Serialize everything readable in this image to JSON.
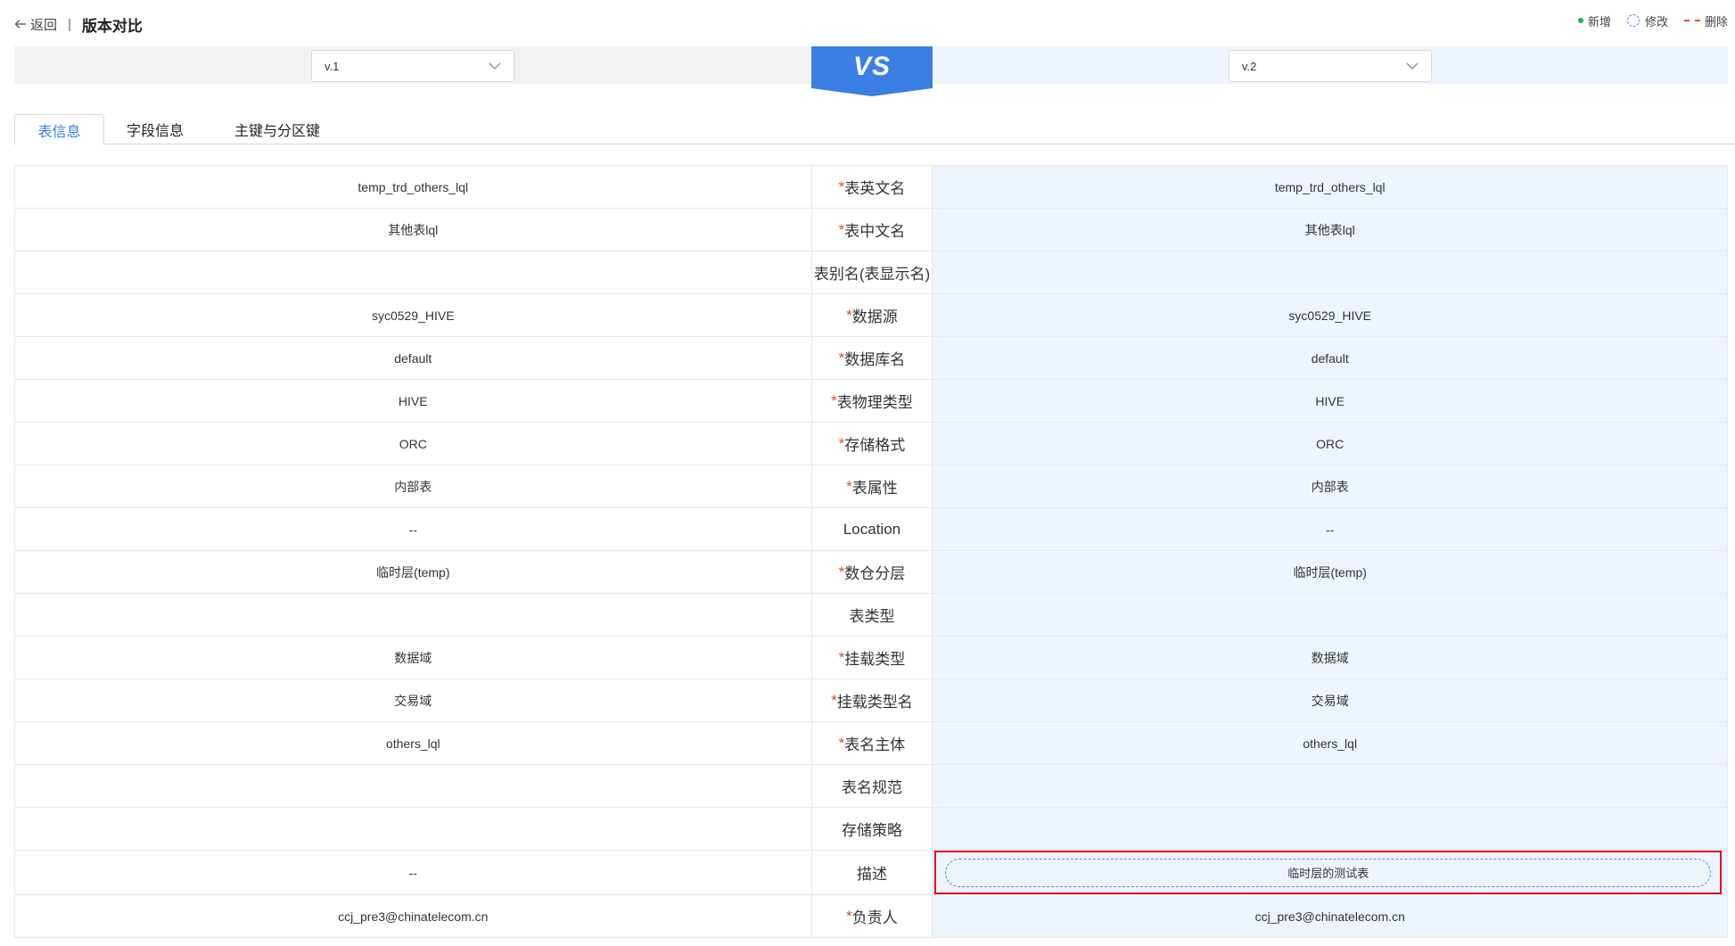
{
  "header": {
    "back_label": "返回",
    "separator": "|",
    "title": "版本对比"
  },
  "legend": {
    "added": "新增",
    "modified": "修改",
    "deleted": "删除"
  },
  "versions": {
    "left": "v.1",
    "right": "v.2",
    "vs_label": "VS"
  },
  "tabs": [
    {
      "label": "表信息",
      "active": true
    },
    {
      "label": "字段信息",
      "active": false
    },
    {
      "label": "主键与分区键",
      "active": false
    }
  ],
  "rows": [
    {
      "label": "表英文名",
      "required": true,
      "left": "temp_trd_others_lql",
      "right": "temp_trd_others_lql"
    },
    {
      "label": "表中文名",
      "required": true,
      "left": "其他表lql",
      "right": "其他表lql"
    },
    {
      "label": "表别名(表显示名)",
      "required": false,
      "left": "",
      "right": ""
    },
    {
      "label": "数据源",
      "required": true,
      "left": "syc0529_HIVE",
      "right": "syc0529_HIVE"
    },
    {
      "label": "数据库名",
      "required": true,
      "left": "default",
      "right": "default"
    },
    {
      "label": "表物理类型",
      "required": true,
      "left": "HIVE",
      "right": "HIVE"
    },
    {
      "label": "存储格式",
      "required": true,
      "left": "ORC",
      "right": "ORC"
    },
    {
      "label": "表属性",
      "required": true,
      "left": "内部表",
      "right": "内部表"
    },
    {
      "label": "Location",
      "required": false,
      "left": "--",
      "right": "--"
    },
    {
      "label": "数仓分层",
      "required": true,
      "left": "临时层(temp)",
      "right": "临时层(temp)"
    },
    {
      "label": "表类型",
      "required": false,
      "left": "",
      "right": ""
    },
    {
      "label": "挂载类型",
      "required": true,
      "left": "数据域",
      "right": "数据域"
    },
    {
      "label": "挂载类型名",
      "required": true,
      "left": "交易域",
      "right": "交易域"
    },
    {
      "label": "表名主体",
      "required": true,
      "left": "others_lql",
      "right": "others_lql"
    },
    {
      "label": "表名规范",
      "required": false,
      "left": "",
      "right": ""
    },
    {
      "label": "存储策略",
      "required": false,
      "left": "",
      "right": ""
    },
    {
      "label": "描述",
      "required": false,
      "left": "--",
      "right": "临时层的测试表",
      "modified": true
    },
    {
      "label": "负责人",
      "required": true,
      "left": "ccj_pre3@chinatelecom.cn",
      "right": "ccj_pre3@chinatelecom.cn"
    }
  ],
  "colors": {
    "accent": "#3a7ee0",
    "vs_badge": "#3b7fe4",
    "required_star": "#e5472f",
    "highlight": "#e0121f",
    "added": "#1fb35e"
  }
}
